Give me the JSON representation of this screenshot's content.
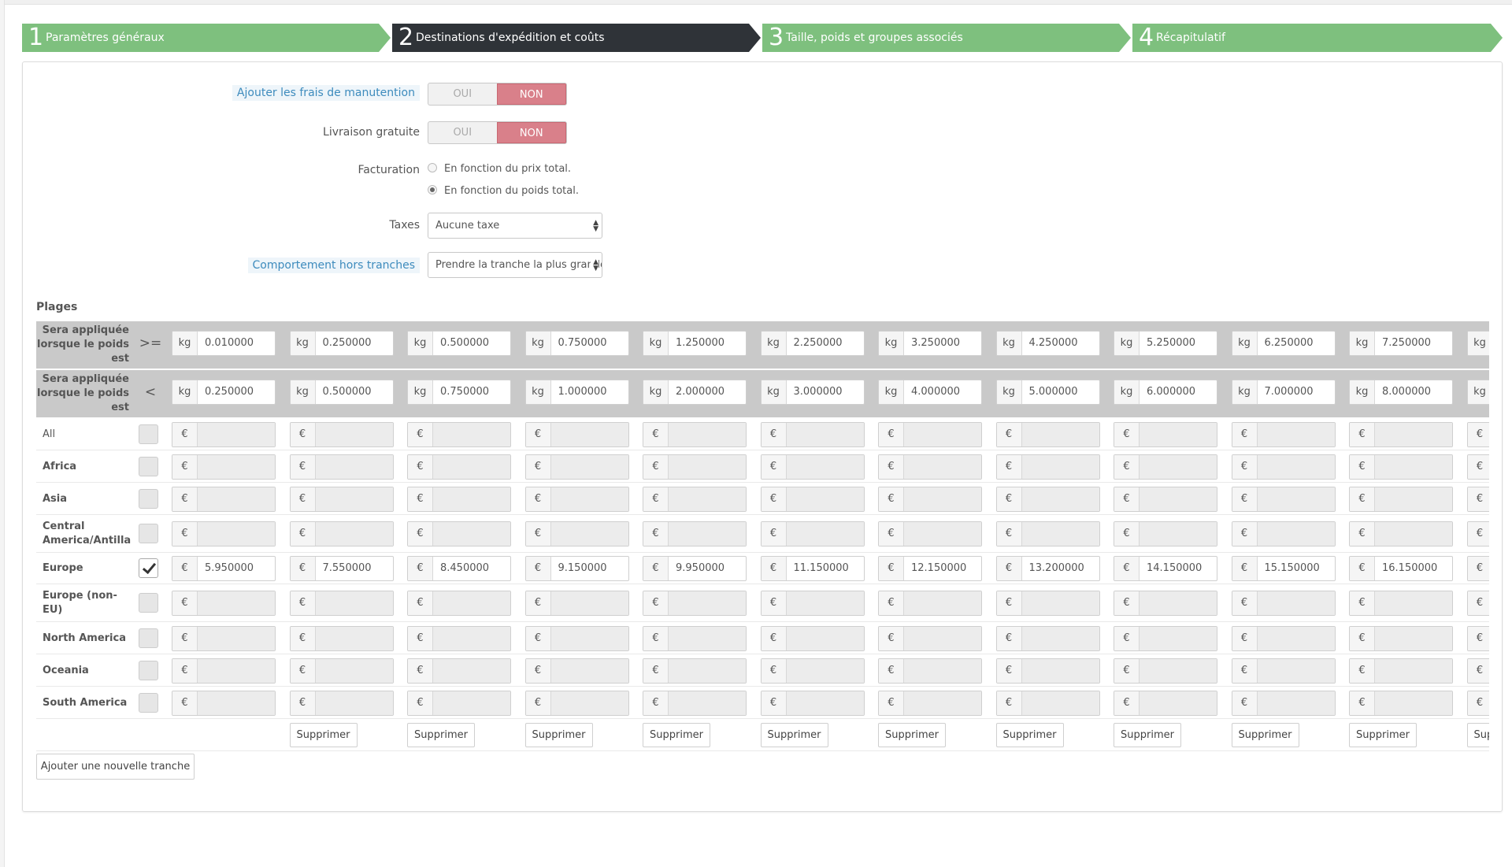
{
  "steps": [
    {
      "num": "1",
      "label": "Paramètres généraux"
    },
    {
      "num": "2",
      "label": "Destinations d'expédition et coûts"
    },
    {
      "num": "3",
      "label": "Taille, poids et groupes associés"
    },
    {
      "num": "4",
      "label": "Récapitulatif"
    }
  ],
  "form": {
    "handling": {
      "label": "Ajouter les frais de manutention",
      "yes": "OUI",
      "no": "NON",
      "value": "NON"
    },
    "free_shipping": {
      "label": "Livraison gratuite",
      "yes": "OUI",
      "no": "NON",
      "value": "NON"
    },
    "billing": {
      "label": "Facturation",
      "options": [
        "En fonction du prix total.",
        "En fonction du poids total."
      ],
      "selected": 1
    },
    "taxes": {
      "label": "Taxes",
      "value": "Aucune taxe"
    },
    "out_of_range": {
      "label": "Comportement hors tranches",
      "value": "Prendre la tranche la plus grande"
    }
  },
  "plages": {
    "title": "Plages",
    "ge_label": "Sera appliquée lorsque le poids est",
    "ge_op": ">=",
    "lt_label": "Sera appliquée lorsque le poids est",
    "lt_op": "<",
    "weight_unit": "kg",
    "currency": "€",
    "ranges_from": [
      "0.010000",
      "0.250000",
      "0.500000",
      "0.750000",
      "1.250000",
      "2.250000",
      "3.250000",
      "4.250000",
      "5.250000",
      "6.250000",
      "7.250000",
      ""
    ],
    "ranges_to": [
      "0.250000",
      "0.500000",
      "0.750000",
      "1.000000",
      "2.000000",
      "3.000000",
      "4.000000",
      "5.000000",
      "6.000000",
      "7.000000",
      "8.000000",
      ""
    ],
    "zones": [
      {
        "name": "All",
        "checked": false,
        "prices": []
      },
      {
        "name": "Africa",
        "checked": false,
        "prices": []
      },
      {
        "name": "Asia",
        "checked": false,
        "prices": []
      },
      {
        "name": "Central America/Antilla",
        "checked": false,
        "prices": []
      },
      {
        "name": "Europe",
        "checked": true,
        "prices": [
          "5.950000",
          "7.550000",
          "8.450000",
          "9.150000",
          "9.950000",
          "11.150000",
          "12.150000",
          "13.200000",
          "14.150000",
          "15.150000",
          "16.150000",
          ""
        ]
      },
      {
        "name": "Europe (non-EU)",
        "checked": false,
        "prices": []
      },
      {
        "name": "North America",
        "checked": false,
        "prices": []
      },
      {
        "name": "Oceania",
        "checked": false,
        "prices": []
      },
      {
        "name": "South America",
        "checked": false,
        "prices": []
      }
    ],
    "delete_label": "Supprimer",
    "add_label": "Ajouter une nouvelle tranche"
  }
}
